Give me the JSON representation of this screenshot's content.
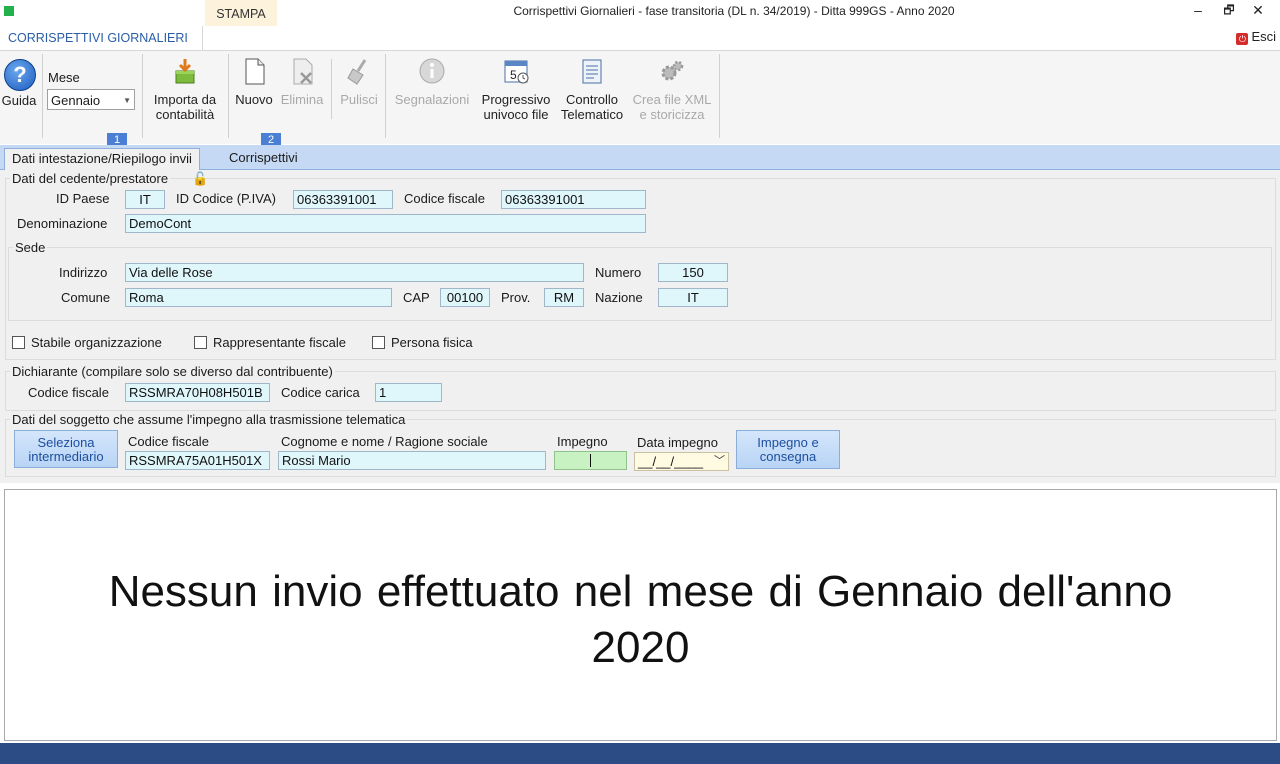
{
  "window": {
    "title": "Corrispettivi Giornalieri - fase transitoria (DL n. 34/2019) - Ditta 999GS - Anno 2020",
    "minimize": "–",
    "restore": "🗗",
    "close": "✕"
  },
  "ribbon_tabs": {
    "main": "CORRISPETTIVI GIORNALIERI",
    "stampa": "STAMPA",
    "exit": "Esci"
  },
  "toolbar": {
    "guida": "Guida",
    "mese_label": "Mese",
    "mese_value": "Gennaio",
    "importa_line1": "Importa da",
    "importa_line2": "contabilità",
    "nuovo": "Nuovo",
    "elimina": "Elimina",
    "pulisci": "Pulisci",
    "segnalazioni": "Segnalazioni",
    "progressivo_line1": "Progressivo",
    "progressivo_line2": "univoco file",
    "controllo_line1": "Controllo",
    "controllo_line2": "Telematico",
    "crea_line1": "Crea file XML",
    "crea_line2": "e storicizza"
  },
  "badges": [
    "1",
    "2"
  ],
  "page_tabs": {
    "dati": "Dati intestazione/Riepilogo invii",
    "corrispettivi": "Corrispettivi"
  },
  "cedente": {
    "title": "Dati del cedente/prestatore",
    "id_paese_label": "ID Paese",
    "id_paese": "IT",
    "id_codice_label": "ID Codice (P.IVA)",
    "id_codice": "06363391001",
    "codice_fiscale_label": "Codice fiscale",
    "codice_fiscale": "06363391001",
    "denominazione_label": "Denominazione",
    "denominazione": "DemoCont"
  },
  "sede": {
    "title": "Sede",
    "indirizzo_label": "Indirizzo",
    "indirizzo": "Via delle Rose",
    "numero_label": "Numero",
    "numero": "150",
    "comune_label": "Comune",
    "comune": "Roma",
    "cap_label": "CAP",
    "cap": "00100",
    "prov_label": "Prov.",
    "prov": "RM",
    "nazione_label": "Nazione",
    "nazione": "IT"
  },
  "checkboxes": {
    "stabile": "Stabile organizzazione",
    "rappresentante": "Rappresentante fiscale",
    "persona": "Persona fisica"
  },
  "dichiarante": {
    "title": "Dichiarante (compilare solo se diverso dal contribuente)",
    "codice_fiscale_label": "Codice fiscale",
    "codice_fiscale": "RSSMRA70H08H501B",
    "codice_carica_label": "Codice carica",
    "codice_carica": "1"
  },
  "impegno": {
    "title": "Dati del soggetto che assume l'impegno alla trasmissione telematica",
    "seleziona_line1": "Seleziona",
    "seleziona_line2": "intermediario",
    "codice_fiscale_label": "Codice fiscale",
    "codice_fiscale": "RSSMRA75A01H501X",
    "nome_label": "Cognome e nome / Ragione sociale",
    "nome": "Rossi Mario",
    "impegno_label": "Impegno",
    "impegno_value": "",
    "data_label": "Data impegno",
    "data_value": "__/__/____",
    "consegna_line1": "Impegno e",
    "consegna_line2": "consegna"
  },
  "message": {
    "line1": "Nessun invio effettuato nel mese di Gennaio dell'anno",
    "line2": "2020"
  }
}
